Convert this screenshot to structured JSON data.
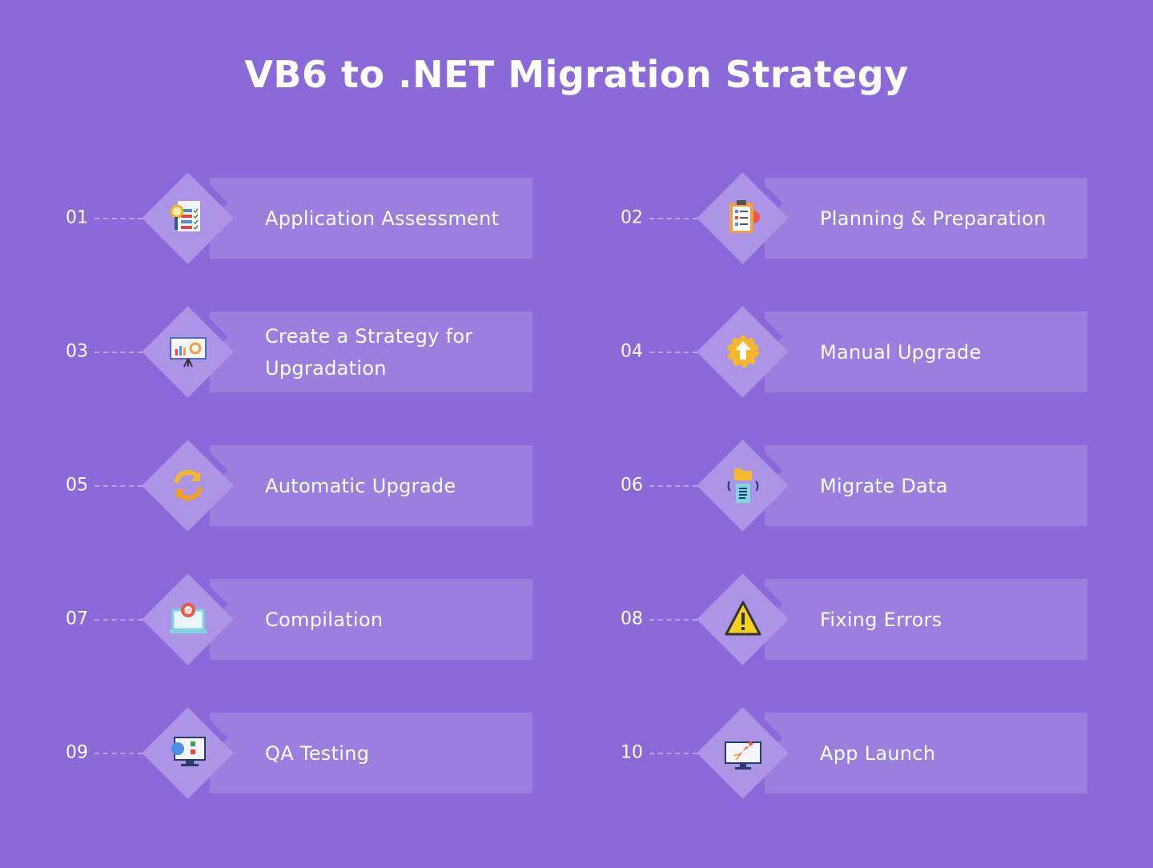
{
  "title": "VB6 to .NET Migration Strategy",
  "colors": {
    "background": "#8a6ad8",
    "card": "#9a7fdf",
    "diamond": "#ac95e6",
    "text": "#ffffff"
  },
  "steps": [
    {
      "number": "01",
      "label": "Application Assessment",
      "icon": "checklist-magnifier-icon"
    },
    {
      "number": "02",
      "label": "Planning & Preparation",
      "icon": "clipboard-gear-icon"
    },
    {
      "number": "03",
      "label": "Create a Strategy for Upgradation",
      "icon": "presentation-board-icon"
    },
    {
      "number": "04",
      "label": "Manual Upgrade",
      "icon": "gear-upload-icon"
    },
    {
      "number": "05",
      "label": "Automatic Upgrade",
      "icon": "refresh-arrows-icon"
    },
    {
      "number": "06",
      "label": "Migrate Data",
      "icon": "folder-transfer-icon"
    },
    {
      "number": "07",
      "label": "Compilation",
      "icon": "laptop-code-icon"
    },
    {
      "number": "08",
      "label": "Fixing Errors",
      "icon": "warning-icon"
    },
    {
      "number": "09",
      "label": "QA Testing",
      "icon": "monitor-testing-icon"
    },
    {
      "number": "10",
      "label": "App Launch",
      "icon": "monitor-rocket-icon"
    }
  ]
}
